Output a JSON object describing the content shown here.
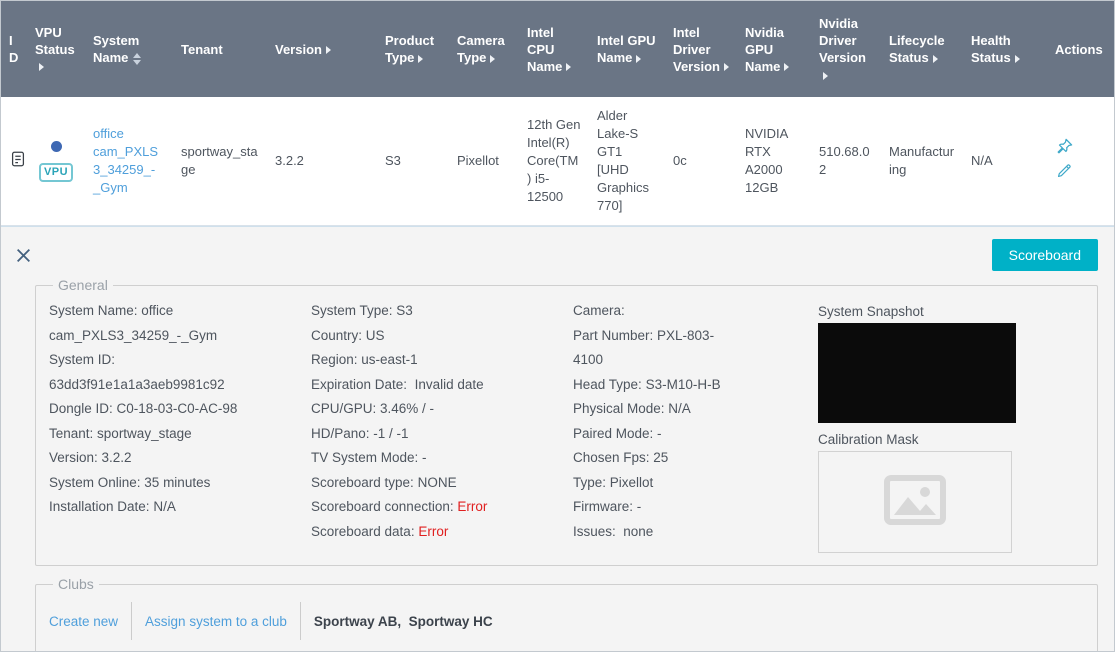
{
  "colors": {
    "header_bg": "#6a7585",
    "accent_teal": "#00b1c7",
    "link_blue": "#4f9fdb",
    "error_red": "#e02020",
    "status_dot_blue": "#3e68b3",
    "icon_teal": "#3fa9c9"
  },
  "table": {
    "columns": [
      {
        "label": "ID",
        "sort": null
      },
      {
        "label": "VPU Status",
        "sort": "arrow"
      },
      {
        "label": "System Name",
        "sort": "both"
      },
      {
        "label": "Tenant",
        "sort": null
      },
      {
        "label": "Version",
        "sort": "arrow"
      },
      {
        "label": "Product Type",
        "sort": "arrow"
      },
      {
        "label": "Camera Type",
        "sort": "arrow"
      },
      {
        "label": "Intel CPU Name",
        "sort": "arrow"
      },
      {
        "label": "Intel GPU Name",
        "sort": "arrow"
      },
      {
        "label": "Intel Driver Version",
        "sort": "arrow"
      },
      {
        "label": "Nvidia GPU Name",
        "sort": "arrow"
      },
      {
        "label": "Nvidia Driver Version",
        "sort": "arrow"
      },
      {
        "label": "Lifecycle Status",
        "sort": "arrow"
      },
      {
        "label": "Health Status",
        "sort": "arrow"
      },
      {
        "label": "Actions",
        "sort": null
      }
    ],
    "row": {
      "id_icon": "copy-id-icon",
      "vpu_status": {
        "dot": "online",
        "badge": "VPU"
      },
      "system_name": "office cam_PXLS3_34259_-_Gym",
      "tenant": "sportway_stage",
      "version": "3.2.2",
      "product_type": "S3",
      "camera_type": "Pixellot",
      "intel_cpu_name": "12th Gen Intel(R) Core(TM) i5-12500",
      "intel_gpu_name": "Alder Lake-S GT1 [UHD Graphics 770]",
      "intel_driver_version": "0c",
      "nvidia_gpu_name": "NVIDIA RTX A2000 12GB",
      "nvidia_driver_version": "510.68.02",
      "lifecycle_status": "Manufacturing",
      "health_status": "N/A",
      "action_icons": [
        "pin-icon",
        "edit-icon"
      ]
    }
  },
  "detail": {
    "scoreboard_button": "Scoreboard",
    "general": {
      "legend": "General",
      "col1": [
        {
          "label": "System Name",
          "value": "office cam_PXLS3_34259_-_Gym"
        },
        {
          "label": "System ID",
          "value": "63dd3f91e1a1a3aeb9981c92"
        },
        {
          "label": "Dongle ID",
          "value": "C0-18-03-C0-AC-98"
        },
        {
          "label": "Tenant",
          "value": "sportway_stage"
        },
        {
          "label": "Version",
          "value": "3.2.2"
        },
        {
          "label": "System Online",
          "value": "35 minutes"
        },
        {
          "label": "Installation Date",
          "value": "N/A"
        }
      ],
      "col2": [
        {
          "label": "System Type",
          "value": "S3"
        },
        {
          "label": "Country",
          "value": "US"
        },
        {
          "label": "Region",
          "value": "us-east-1"
        },
        {
          "label": "Expiration Date",
          "value": " Invalid date"
        },
        {
          "label": "CPU/GPU",
          "value": "3.46% / -"
        },
        {
          "label": "HD/Pano",
          "value": "-1 / -1"
        },
        {
          "label": "TV System Mode",
          "value": "-"
        },
        {
          "label": "Scoreboard type",
          "value": "NONE"
        },
        {
          "label": "Scoreboard connection",
          "value": "Error",
          "error": true
        },
        {
          "label": "Scoreboard data",
          "value": "Error",
          "error": true
        }
      ],
      "col3": [
        {
          "label": "Camera",
          "value": ""
        },
        {
          "label": "Part Number",
          "value": "PXL-803-4100"
        },
        {
          "label": "Head Type",
          "value": "S3-M10-H-B"
        },
        {
          "label": "Physical Mode",
          "value": "N/A"
        },
        {
          "label": "Paired Mode",
          "value": "-"
        },
        {
          "label": "Chosen Fps",
          "value": "25"
        },
        {
          "label": "Type",
          "value": "Pixellot"
        },
        {
          "label": "Firmware",
          "value": "-"
        },
        {
          "label": "Issues",
          "value": " none"
        }
      ],
      "snapshot_label": "System Snapshot",
      "calibration_label": "Calibration Mask"
    },
    "clubs": {
      "legend": "Clubs",
      "create_new": "Create new",
      "assign": "Assign system to a club",
      "names": "Sportway AB,  Sportway HC"
    }
  }
}
